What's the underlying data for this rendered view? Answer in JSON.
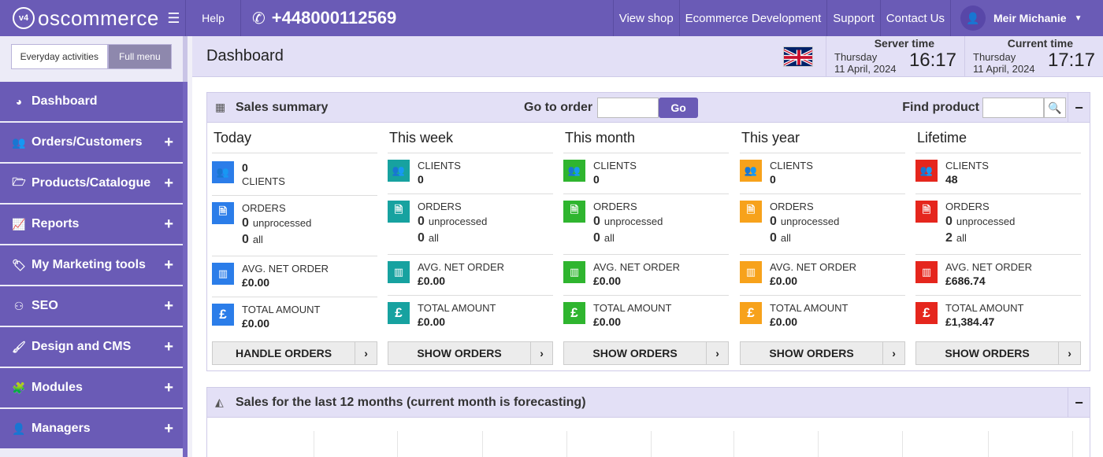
{
  "topbar": {
    "logo_text": "oscommerce",
    "logo_mark": "v4",
    "help": "Help",
    "phone": "+448000112569",
    "nav": [
      "View shop",
      "Ecommerce Development",
      "Support",
      "Contact Us"
    ],
    "user": "Meir Michanie"
  },
  "sidebar": {
    "toggle_everyday": "Everyday activities",
    "toggle_full": "Full menu",
    "items": [
      {
        "label": "Dashboard",
        "icon": "dashboard-icon",
        "glyph": "◕",
        "expandable": false
      },
      {
        "label": "Orders/Customers",
        "icon": "users-icon",
        "glyph": "👥",
        "expandable": true
      },
      {
        "label": "Products/Catalogue",
        "icon": "folder-icon",
        "glyph": "🗁",
        "expandable": true
      },
      {
        "label": "Reports",
        "icon": "line-chart-icon",
        "glyph": "📈",
        "expandable": true
      },
      {
        "label": "My Marketing tools",
        "icon": "tag-icon",
        "glyph": "🏷",
        "expandable": true
      },
      {
        "label": "SEO",
        "icon": "sitemap-icon",
        "glyph": "⚇",
        "expandable": true
      },
      {
        "label": "Design and CMS",
        "icon": "brush-icon",
        "glyph": "🖌",
        "expandable": true
      },
      {
        "label": "Modules",
        "icon": "puzzle-icon",
        "glyph": "🧩",
        "expandable": true
      },
      {
        "label": "Managers",
        "icon": "user-icon",
        "glyph": "👤",
        "expandable": true
      }
    ]
  },
  "header": {
    "title": "Dashboard",
    "server_time": {
      "label": "Server time",
      "day": "Thursday",
      "date": "11 April, 2024",
      "clock": "16:17"
    },
    "current_time": {
      "label": "Current time",
      "day": "Thursday",
      "date": "11 April, 2024",
      "clock": "17:17"
    }
  },
  "sales_summary": {
    "title": "Sales summary",
    "goto_label": "Go to order",
    "go_button": "Go",
    "find_label": "Find product",
    "columns": [
      {
        "title": "Today",
        "color": "#2b7de9",
        "clients_label": "CLIENTS",
        "clients": "0",
        "orders_label": "ORDERS",
        "unprocessed": "0",
        "unprocessed_label": "unprocessed",
        "all": "0",
        "all_label": "all",
        "avg_label": "AVG. NET ORDER",
        "avg": "£0.00",
        "total_label": "TOTAL AMOUNT",
        "total": "£0.00",
        "button": "HANDLE ORDERS"
      },
      {
        "title": "This week",
        "color": "#17a2a0",
        "clients_label": "CLIENTS",
        "clients": "0",
        "orders_label": "ORDERS",
        "unprocessed": "0",
        "unprocessed_label": "unprocessed",
        "all": "0",
        "all_label": "all",
        "avg_label": "AVG. NET ORDER",
        "avg": "£0.00",
        "total_label": "TOTAL AMOUNT",
        "total": "£0.00",
        "button": "SHOW ORDERS"
      },
      {
        "title": "This month",
        "color": "#2fb52f",
        "clients_label": "CLIENTS",
        "clients": "0",
        "orders_label": "ORDERS",
        "unprocessed": "0",
        "unprocessed_label": "unprocessed",
        "all": "0",
        "all_label": "all",
        "avg_label": "AVG. NET ORDER",
        "avg": "£0.00",
        "total_label": "TOTAL AMOUNT",
        "total": "£0.00",
        "button": "SHOW ORDERS"
      },
      {
        "title": "This year",
        "color": "#f7a21b",
        "clients_label": "CLIENTS",
        "clients": "0",
        "orders_label": "ORDERS",
        "unprocessed": "0",
        "unprocessed_label": "unprocessed",
        "all": "0",
        "all_label": "all",
        "avg_label": "AVG. NET ORDER",
        "avg": "£0.00",
        "total_label": "TOTAL AMOUNT",
        "total": "£0.00",
        "button": "SHOW ORDERS"
      },
      {
        "title": "Lifetime",
        "color": "#e5261d",
        "clients_label": "CLIENTS",
        "clients": "48",
        "orders_label": "ORDERS",
        "unprocessed": "0",
        "unprocessed_label": "unprocessed",
        "all": "2",
        "all_label": "all",
        "avg_label": "AVG. NET ORDER",
        "avg": "£686.74",
        "total_label": "TOTAL AMOUNT",
        "total": "£1,384.47",
        "button": "SHOW ORDERS"
      }
    ]
  },
  "sales_chart": {
    "title": "Sales for the last 12 months (current month is forecasting)"
  }
}
